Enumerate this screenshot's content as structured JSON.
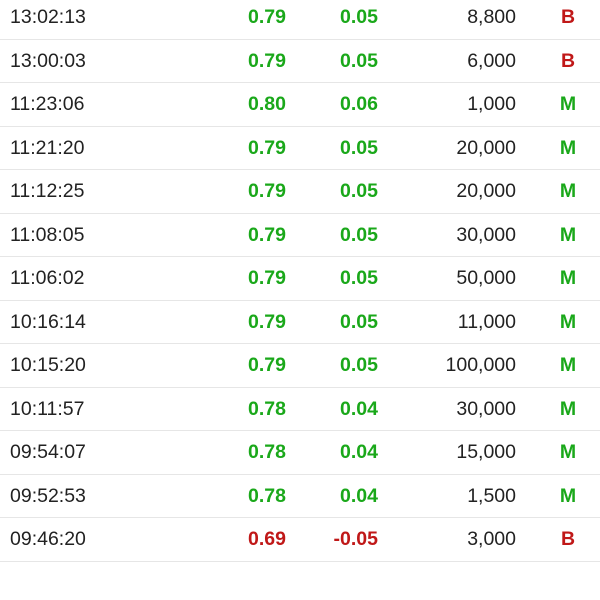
{
  "colors": {
    "up": "#1aa81a",
    "down": "#c01818",
    "side_b": "#c01818",
    "side_m": "#1aa81a",
    "text": "#222222",
    "divider": "#e6e6e6"
  },
  "trades": [
    {
      "time": "13:02:13",
      "price": "0.79",
      "change": "0.05",
      "volume": "8,800",
      "side": "B",
      "direction": "up"
    },
    {
      "time": "13:00:03",
      "price": "0.79",
      "change": "0.05",
      "volume": "6,000",
      "side": "B",
      "direction": "up"
    },
    {
      "time": "11:23:06",
      "price": "0.80",
      "change": "0.06",
      "volume": "1,000",
      "side": "M",
      "direction": "up"
    },
    {
      "time": "11:21:20",
      "price": "0.79",
      "change": "0.05",
      "volume": "20,000",
      "side": "M",
      "direction": "up"
    },
    {
      "time": "11:12:25",
      "price": "0.79",
      "change": "0.05",
      "volume": "20,000",
      "side": "M",
      "direction": "up"
    },
    {
      "time": "11:08:05",
      "price": "0.79",
      "change": "0.05",
      "volume": "30,000",
      "side": "M",
      "direction": "up"
    },
    {
      "time": "11:06:02",
      "price": "0.79",
      "change": "0.05",
      "volume": "50,000",
      "side": "M",
      "direction": "up"
    },
    {
      "time": "10:16:14",
      "price": "0.79",
      "change": "0.05",
      "volume": "11,000",
      "side": "M",
      "direction": "up"
    },
    {
      "time": "10:15:20",
      "price": "0.79",
      "change": "0.05",
      "volume": "100,000",
      "side": "M",
      "direction": "up"
    },
    {
      "time": "10:11:57",
      "price": "0.78",
      "change": "0.04",
      "volume": "30,000",
      "side": "M",
      "direction": "up"
    },
    {
      "time": "09:54:07",
      "price": "0.78",
      "change": "0.04",
      "volume": "15,000",
      "side": "M",
      "direction": "up"
    },
    {
      "time": "09:52:53",
      "price": "0.78",
      "change": "0.04",
      "volume": "1,500",
      "side": "M",
      "direction": "up"
    },
    {
      "time": "09:46:20",
      "price": "0.69",
      "change": "-0.05",
      "volume": "3,000",
      "side": "B",
      "direction": "down"
    }
  ]
}
